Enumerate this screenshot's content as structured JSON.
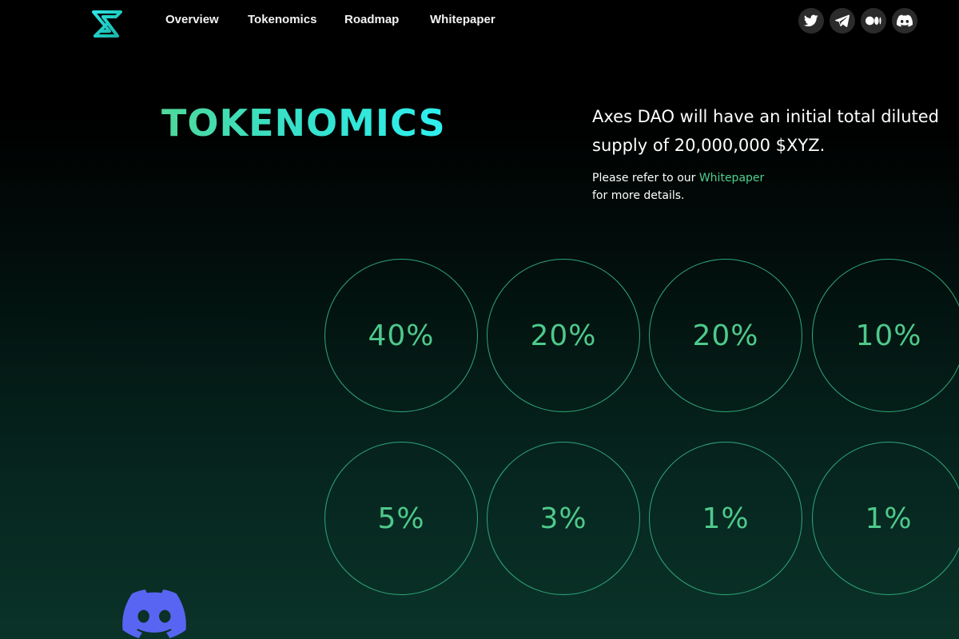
{
  "nav": {
    "logo_icon": "axes-dao-logo-icon",
    "items": [
      {
        "label": "Overview"
      },
      {
        "label": "Tokenomics"
      },
      {
        "label": "Roadmap"
      },
      {
        "label": "Whitepaper"
      }
    ],
    "social": [
      {
        "icon": "twitter-icon"
      },
      {
        "icon": "telegram-icon"
      },
      {
        "icon": "medium-icon"
      },
      {
        "icon": "discord-icon"
      }
    ]
  },
  "tokenomics": {
    "title": "TOKENOMICS",
    "lead_line1": "Axes DAO will have an initial total diluted",
    "lead_line2": "supply of 20,000,000 $XYZ.",
    "note_prefix": "Please refer to our ",
    "note_link": "Whitepaper",
    "note_suffix": "for more details.",
    "allocations": [
      {
        "value": "40%"
      },
      {
        "value": "20%"
      },
      {
        "value": "20%"
      },
      {
        "value": "10%"
      },
      {
        "value": "5%"
      },
      {
        "value": "3%"
      },
      {
        "value": "1%"
      },
      {
        "value": "1%"
      }
    ]
  },
  "floating": {
    "icon": "discord-icon"
  },
  "colors": {
    "accent_green": "#4ec98b",
    "accent_cyan": "#2ef0f0",
    "circle_border": "#2fa779",
    "discord_blurple": "#5865f2"
  }
}
